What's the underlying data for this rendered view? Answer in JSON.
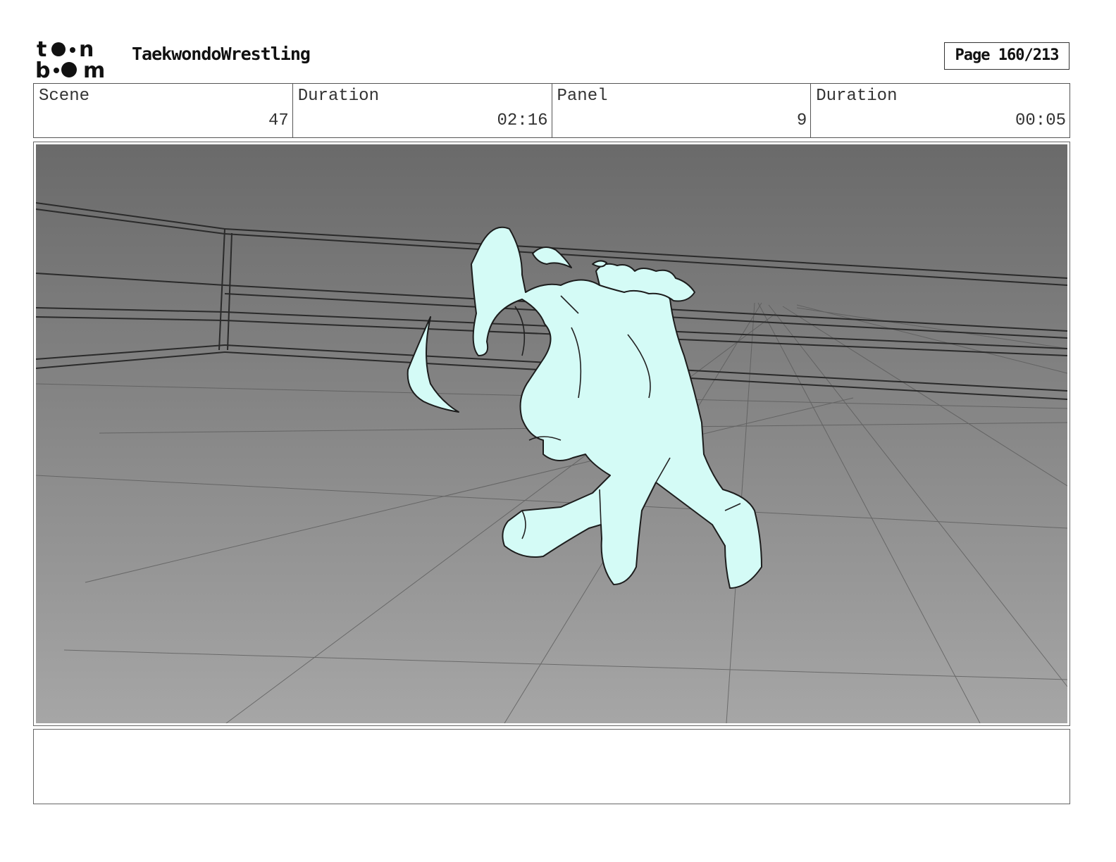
{
  "header": {
    "logo_text": "toonboom",
    "project_title": "TaekwondoWrestling",
    "page_label": "Page 160/213"
  },
  "info": {
    "scene_label": "Scene",
    "scene_value": "47",
    "scene_duration_label": "Duration",
    "scene_duration_value": "02:16",
    "panel_label": "Panel",
    "panel_value": "9",
    "panel_duration_label": "Duration",
    "panel_duration_value": "00:05"
  },
  "panel": {
    "figure_color": "#d4fbf6",
    "background_top": "#6a6a6a",
    "background_bottom": "#a6a6a6"
  },
  "notes": {
    "text": ""
  }
}
